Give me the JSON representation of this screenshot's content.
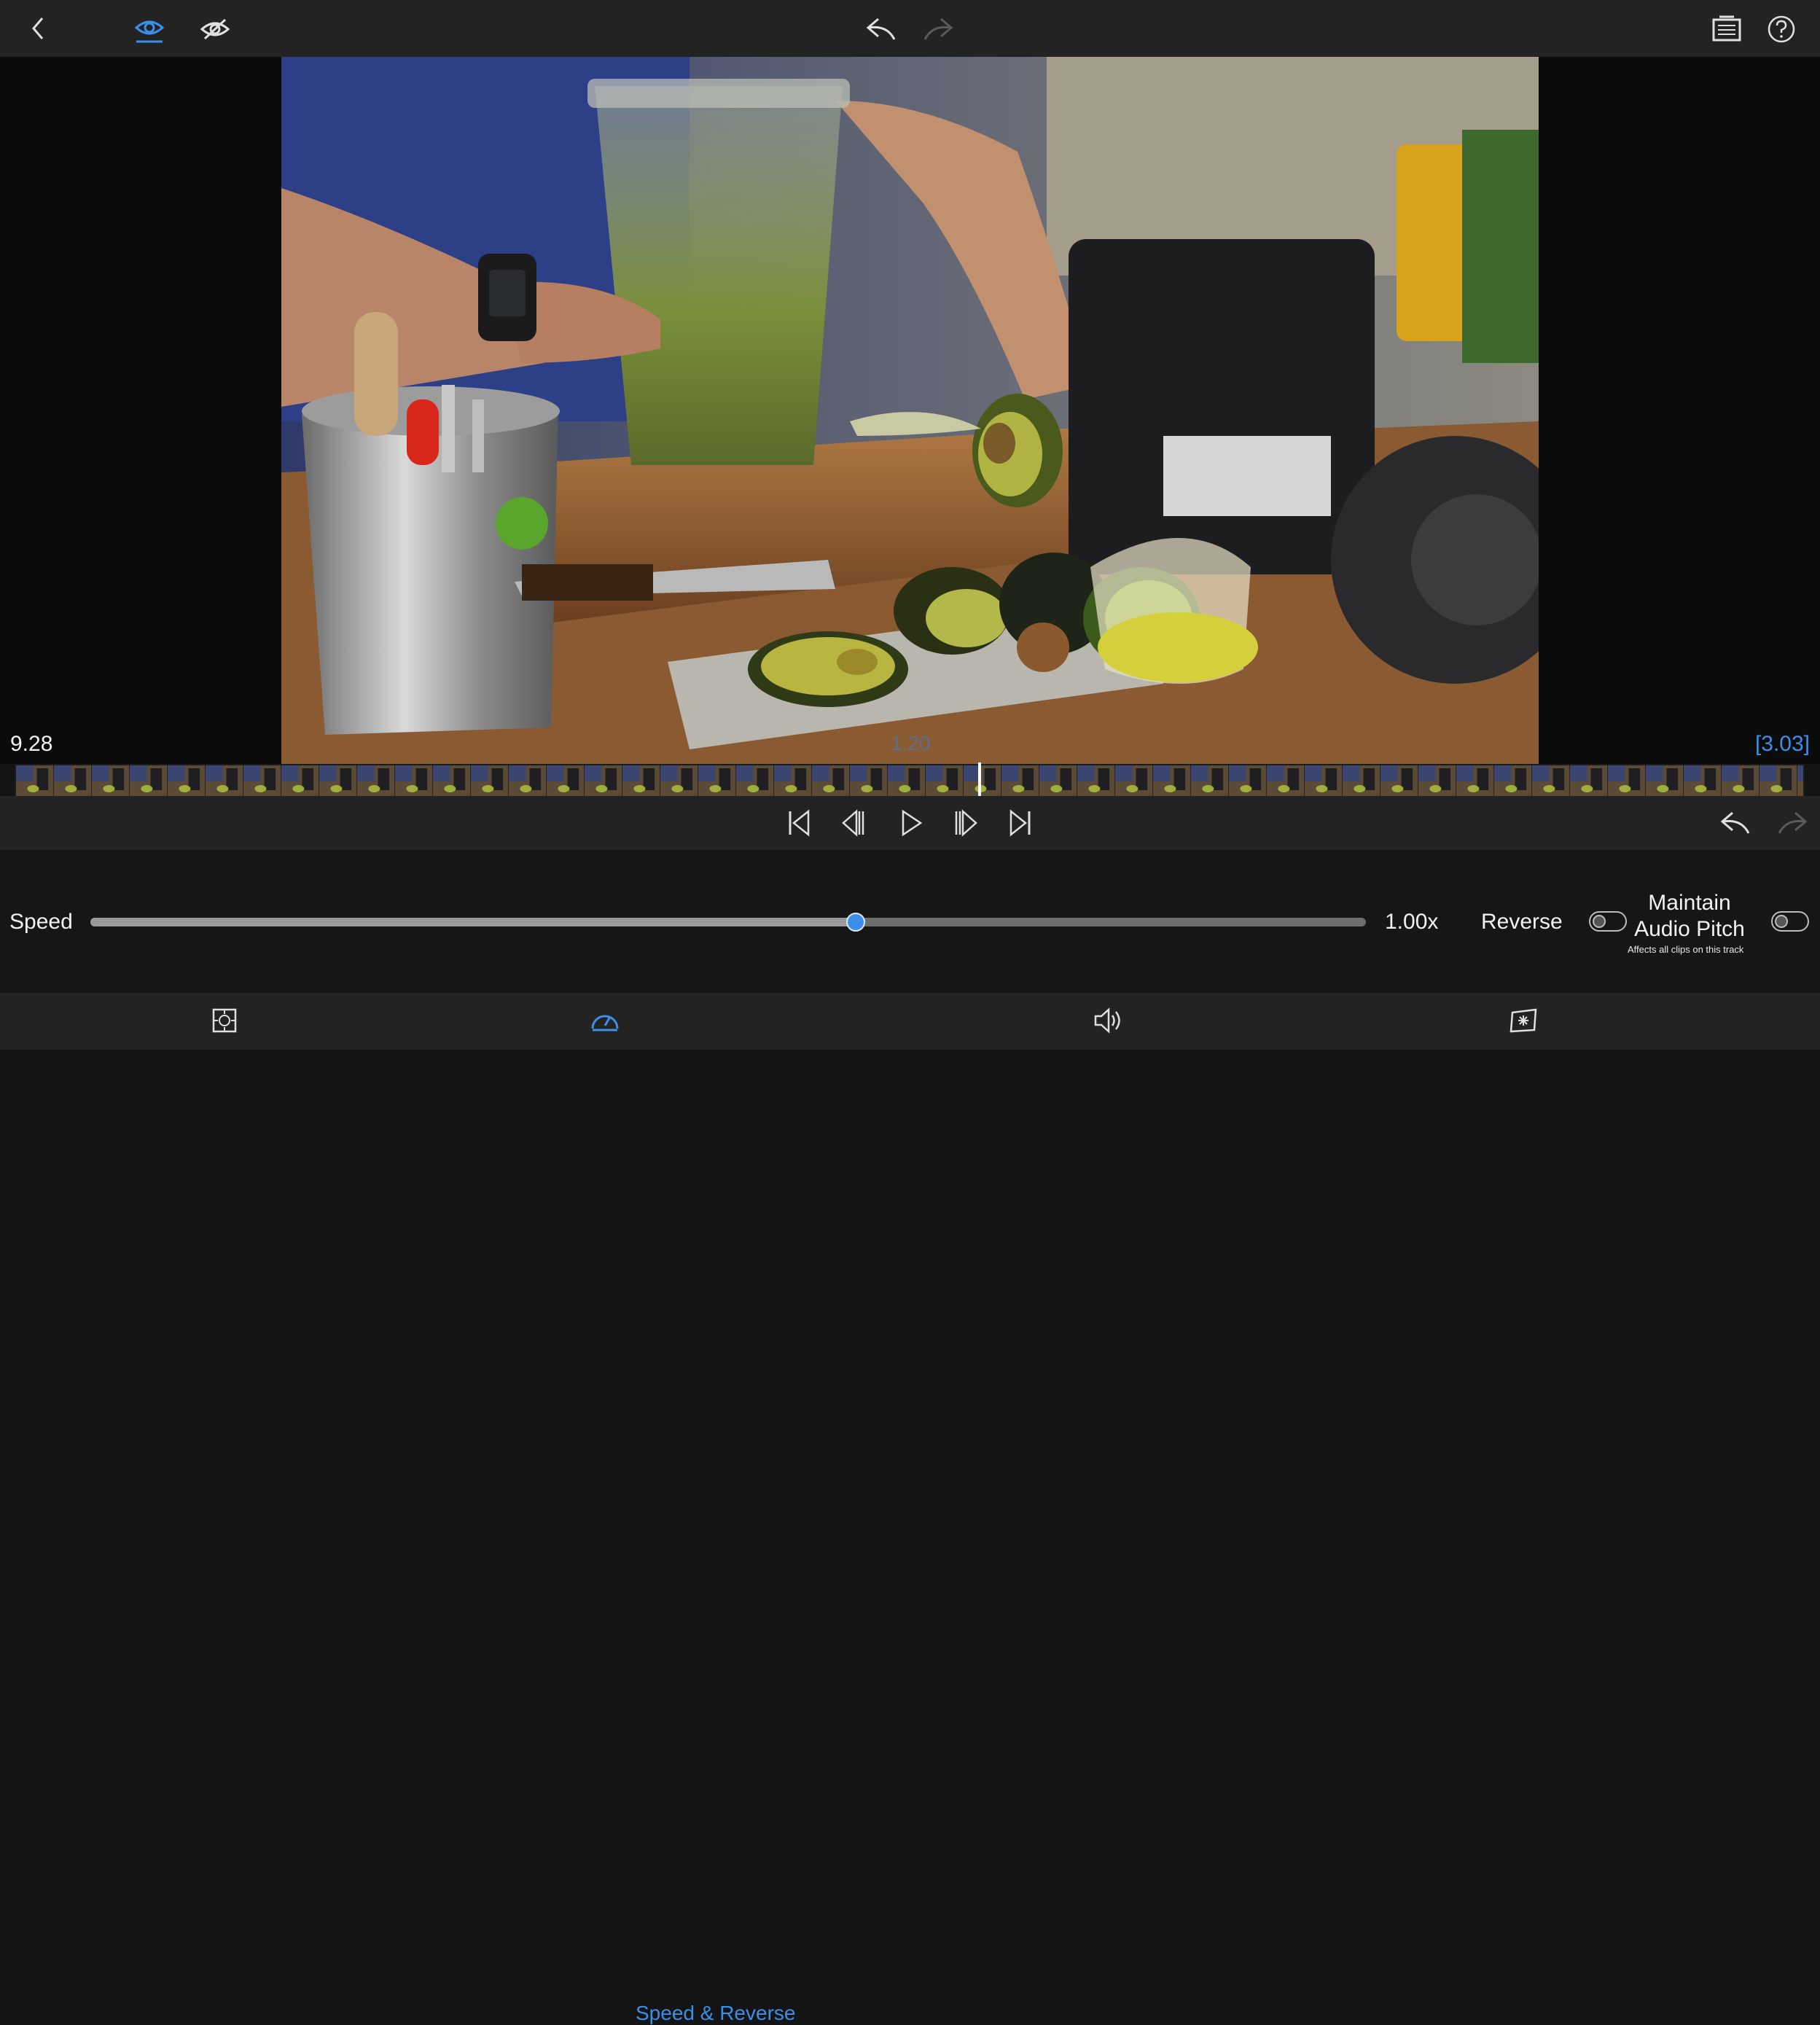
{
  "top_toolbar": {
    "icons": [
      "back-chevron-icon",
      "eye-visible-icon",
      "eye-hidden-icon",
      "undo-icon",
      "redo-icon",
      "list-panel-icon",
      "help-icon"
    ],
    "accent": "#3b8fe8"
  },
  "preview": {
    "image": "kitchen-avocado-scene",
    "time_left": "9.28",
    "time_playhead": "1.20",
    "time_right": "[3.03]",
    "playhead_position": 0.54
  },
  "transport": {
    "icons": [
      "skip-to-start-icon",
      "step-back-icon",
      "play-icon",
      "step-forward-icon",
      "skip-to-end-icon",
      "undo-icon",
      "redo-icon"
    ]
  },
  "speed_panel": {
    "speed_label": "Speed",
    "speed_value_text": "1.00x",
    "speed_level": 0.6,
    "reverse_label": "Reverse",
    "reverse_on": false,
    "maintain_line1": "Maintain",
    "maintain_line2": "Audio Pitch",
    "maintain_note": "Affects all clips on this track",
    "maintain_on": false
  },
  "bottom_tabs": {
    "tabs": [
      {
        "icon": "transform-icon",
        "label": ""
      },
      {
        "icon": "speedometer-icon",
        "label": "Speed & Reverse"
      },
      {
        "icon": "volume-icon",
        "label": ""
      },
      {
        "icon": "effects-icon",
        "label": ""
      }
    ],
    "active_index": 1
  }
}
